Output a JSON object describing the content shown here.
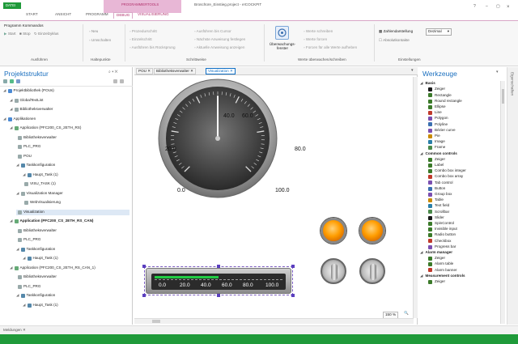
{
  "titlebar": {
    "app_menu": "DATEI",
    "title": "Broschüre_Einstieg.project - e!COCKPIT",
    "context_group": "PROGRAMMIERTOOLS",
    "tabs": [
      "START",
      "ANSICHT",
      "PROGRAMM",
      "DEBUG",
      "VISUALISIERUNG"
    ],
    "active_tab": "DEBUG",
    "window_controls": [
      "?",
      "–",
      "▢",
      "×"
    ]
  },
  "ribbon": {
    "groups": [
      {
        "label": "Ausführen",
        "items": [
          "Programm Kommandos",
          "Start",
          "Stop",
          "Einzelzyklus"
        ]
      },
      {
        "label": "Haltepunkte",
        "items": [
          "Neu",
          "Umschalten"
        ]
      },
      {
        "label": "Schrittweise",
        "items": [
          "Prozedurschritt",
          "Einzelschritt",
          "Ausführen bis Rücksprung",
          "Ausführen bis Cursor",
          "Nächste Anweisung festlegen",
          "Aktuelle Anweisung anzeigen"
        ]
      },
      {
        "label": "Werte überwachen/schreiben",
        "items": [
          "Überwachungs-fenster",
          "Werte schreiben",
          "Werte forcen",
          "Forcen für alle Werte aufheben"
        ]
      },
      {
        "label": "Einstellungen",
        "items": [
          "Zahlendarstellung",
          "Dezimal",
          "Absolutkontakte"
        ]
      }
    ]
  },
  "project": {
    "title": "Projektstruktur",
    "tree": [
      {
        "label": "Projektbibliothek (POUs)",
        "level": 0,
        "bold": false
      },
      {
        "label": "GlobalTextList",
        "level": 1,
        "bold": false
      },
      {
        "label": "Bibliotheksverwalter",
        "level": 1,
        "bold": false
      },
      {
        "label": "Applikationen",
        "level": 0,
        "bold": false
      },
      {
        "label": "Application (PFC200_CS_2ETH_RS)",
        "level": 1,
        "bold": false
      },
      {
        "label": "Bibliotheksverwalter",
        "level": 2,
        "bold": false
      },
      {
        "label": "PLC_PRG",
        "level": 2,
        "bold": false
      },
      {
        "label": "POU",
        "level": 2,
        "bold": false
      },
      {
        "label": "Taskkonfiguration",
        "level": 2,
        "bold": false
      },
      {
        "label": "Haupt_Task (1)",
        "level": 3,
        "bold": false
      },
      {
        "label": "VISU_TASK (1)",
        "level": 3,
        "bold": false
      },
      {
        "label": "Visualization Manager",
        "level": 2,
        "bold": false
      },
      {
        "label": "WebVisualisierung",
        "level": 3,
        "bold": false
      },
      {
        "label": "Visualization",
        "level": 2,
        "bold": false,
        "selected": true
      },
      {
        "label": "Application (PFC200_CS_2ETH_RS_CAN)",
        "level": 1,
        "bold": true
      },
      {
        "label": "Bibliotheksverwalter",
        "level": 2,
        "bold": false
      },
      {
        "label": "PLC_PRG",
        "level": 2,
        "bold": false
      },
      {
        "label": "Taskkonfiguration",
        "level": 2,
        "bold": false
      },
      {
        "label": "Haupt_Task (1)",
        "level": 3,
        "bold": false
      },
      {
        "label": "Application (PFC200_CS_2ETH_RS_CAN_1)",
        "level": 1,
        "bold": false
      },
      {
        "label": "Bibliotheksverwalter",
        "level": 2,
        "bold": false
      },
      {
        "label": "PLC_PRG",
        "level": 2,
        "bold": false
      },
      {
        "label": "Taskkonfiguration",
        "level": 2,
        "bold": false
      },
      {
        "label": "Haupt_Task (1)",
        "level": 3,
        "bold": false
      }
    ]
  },
  "doc": {
    "tabs": [
      "POU",
      "Bibliotheksverwalter",
      "Visualization"
    ],
    "active_tab": "Visualization",
    "gauge": {
      "ticks": [
        "0.0",
        "20.0",
        "40.0",
        "60.0",
        "80.0",
        "100.0"
      ],
      "value": 50,
      "min": 0,
      "max": 100
    },
    "bar": {
      "ticks": [
        "0.0",
        "20.0",
        "40.0",
        "60.0",
        "80.0",
        "100.0"
      ],
      "value": 0.5
    },
    "zoom": "150 %"
  },
  "tools": {
    "title": "Werkzeuge",
    "categories": [
      {
        "name": "Basis",
        "items": [
          "Zeiger",
          "Rectangle",
          "Round rectangle",
          "Ellipse",
          "Line",
          "Polygon",
          "Polyline",
          "Bézier curve",
          "Pie",
          "Image",
          "Frame"
        ]
      },
      {
        "name": "Common controls",
        "items": [
          "Zeiger",
          "Label",
          "Combo box integer",
          "Combo box array",
          "Tab control",
          "Button",
          "Group box",
          "Table",
          "Text field",
          "Scrollbar",
          "Slider",
          "SpinControl",
          "Invisible input",
          "Radio button",
          "Checkbox",
          "Progress bar"
        ]
      },
      {
        "name": "Alarm manager",
        "items": [
          "Zeiger",
          "Alarm table",
          "Alarm banner"
        ]
      },
      {
        "name": "Measurement controls",
        "items": [
          "Zeiger"
        ]
      }
    ]
  },
  "right_strip": {
    "label": "Eigenschaften"
  },
  "messages": {
    "tab": "Meldungen"
  },
  "colors": {
    "accent": "#1f9a3a",
    "context": "#e8b7d6",
    "tab_active": "#0f6fc6"
  }
}
